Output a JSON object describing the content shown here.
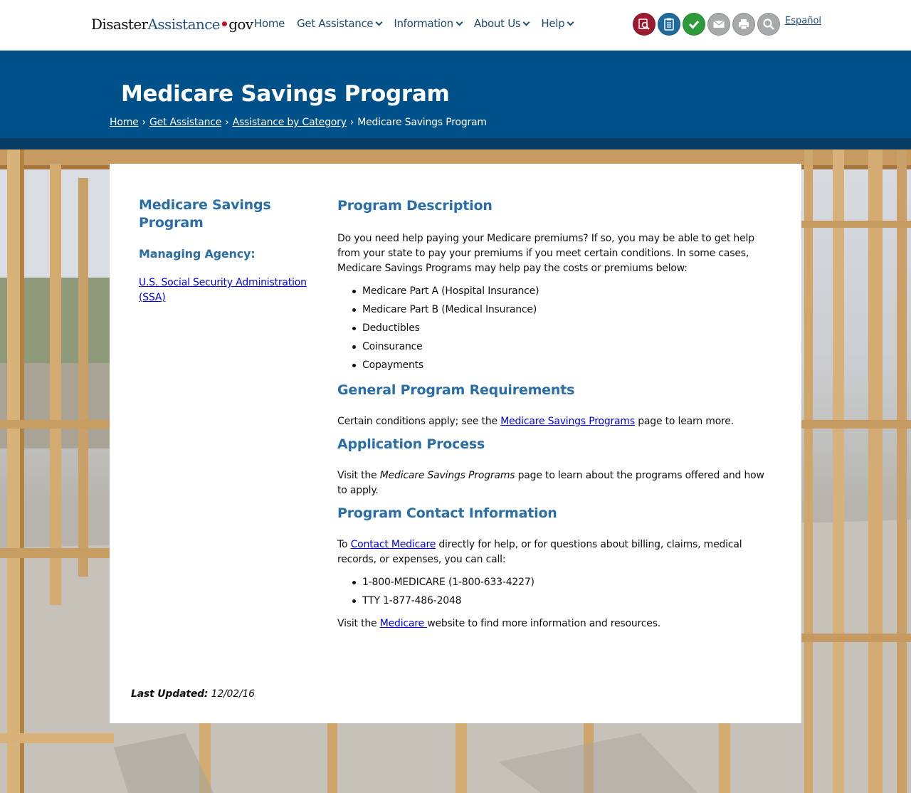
{
  "site": {
    "logo_part1": "Disaster",
    "logo_part2": "Assistance",
    "logo_dot": "•",
    "logo_part3": "gov",
    "nav": [
      {
        "label": "Home",
        "has_dropdown": false
      },
      {
        "label": "Get Assistance",
        "has_dropdown": true
      },
      {
        "label": "Information",
        "has_dropdown": true
      },
      {
        "label": "About Us",
        "has_dropdown": true
      },
      {
        "label": "Help",
        "has_dropdown": true
      }
    ],
    "tools": [
      {
        "icon": "find-assistance-icon",
        "color": "#9b1b30"
      },
      {
        "icon": "clipboard-checklist-icon",
        "color": "#1e6a9c"
      },
      {
        "icon": "checkmark-status-icon",
        "color": "#2e9b3a"
      },
      {
        "icon": "email-icon",
        "color": "#a7a9ab"
      },
      {
        "icon": "print-icon",
        "color": "#a7a9ab"
      },
      {
        "icon": "search-icon",
        "color": "#a7a9ab"
      }
    ],
    "language_link": "Español"
  },
  "header": {
    "title": "Medicare Savings Program",
    "breadcrumb": [
      "Home",
      "Get Assistance",
      "Assistance by Category"
    ],
    "breadcrumb_current": "Medicare Savings Program",
    "breadcrumb_sep": "›"
  },
  "sidebar": {
    "title": "Medicare Savings Program",
    "agency_heading": "Managing Agency:",
    "agency_link": "U.S. Social Security Administration (SSA)"
  },
  "content": {
    "description": {
      "heading": "Program Description",
      "text": "Do you need help paying your Medicare premiums? If so, you may be able to get help from your state to pay your premiums if you meet certain conditions. In some cases, Medicare Savings Programs may help pay the costs or premiums below:",
      "items": [
        "Medicare Part A (Hospital Insurance)",
        "Medicare Part B (Medical Insurance)",
        "Deductibles",
        "Coinsurance",
        "Copayments"
      ]
    },
    "requirements": {
      "heading": "General Program Requirements",
      "text_before": "Certain conditions apply; see the ",
      "link": "Medicare Savings Programs",
      "text_after": " page to learn more."
    },
    "application": {
      "heading": "Application Process",
      "text_before": "Visit the ",
      "emphasis": "Medicare Savings Programs",
      "text_after": " page to learn about the programs offered and how to apply."
    },
    "contact": {
      "heading": "Program Contact Information",
      "text_before": "To ",
      "link": "Contact Medicare",
      "text_after": " directly for help, or for questions about billing, claims, medical records, or expenses, you can call:",
      "items": [
        "1-800-MEDICARE (1-800-633-4227)",
        "TTY 1-877-486-2048"
      ],
      "footer_before": "Visit the ",
      "footer_link": "Medicare ",
      "footer_after": "website to find more information and resources."
    }
  },
  "last_updated": {
    "label": "Last Updated:",
    "date": "12/02/16"
  },
  "colors": {
    "header_blue": "#005189",
    "heading_blue": "#2a6ea7",
    "link": "#0000ee"
  }
}
